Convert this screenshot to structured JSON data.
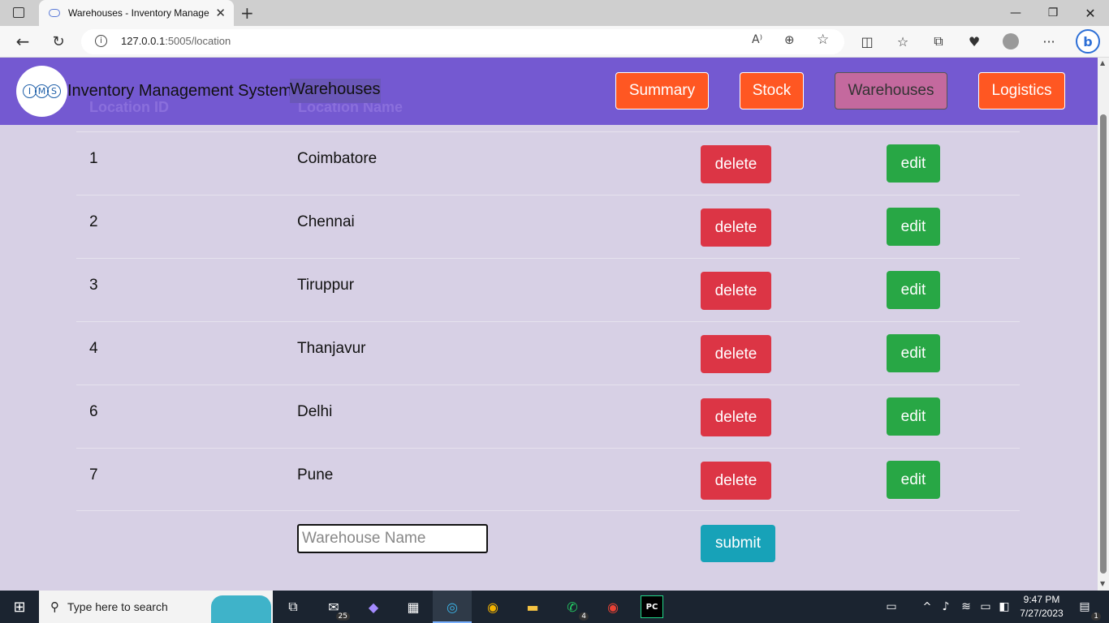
{
  "browser": {
    "tab_title": "Warehouses - Inventory Manage",
    "url_host": "127.0.0.1",
    "url_path": ":5005/location"
  },
  "header": {
    "logo_letters": [
      "I",
      "M",
      "S"
    ],
    "brand": "Inventory Management System",
    "page_title": "Warehouses",
    "nav": [
      {
        "label": "Summary",
        "active": false
      },
      {
        "label": "Stock",
        "active": false
      },
      {
        "label": "Warehouses",
        "active": true
      },
      {
        "label": "Logistics",
        "active": false
      }
    ]
  },
  "table": {
    "columns": [
      "Location ID",
      "Location Name"
    ],
    "rows": [
      {
        "id": "1",
        "name": "Coimbatore",
        "delete": "delete",
        "edit": "edit"
      },
      {
        "id": "2",
        "name": "Chennai",
        "delete": "delete",
        "edit": "edit"
      },
      {
        "id": "3",
        "name": "Tiruppur",
        "delete": "delete",
        "edit": "edit"
      },
      {
        "id": "4",
        "name": "Thanjavur",
        "delete": "delete",
        "edit": "edit"
      },
      {
        "id": "6",
        "name": "Delhi",
        "delete": "delete",
        "edit": "edit"
      },
      {
        "id": "7",
        "name": "Pune",
        "delete": "delete",
        "edit": "edit"
      }
    ]
  },
  "form": {
    "placeholder": "Warehouse Name",
    "submit": "submit"
  },
  "taskbar": {
    "search_placeholder": "Type here to search",
    "mail_badge": "25",
    "whatsapp_badge": "4",
    "time": "9:47 PM",
    "date": "7/27/2023",
    "notifications": "1"
  }
}
